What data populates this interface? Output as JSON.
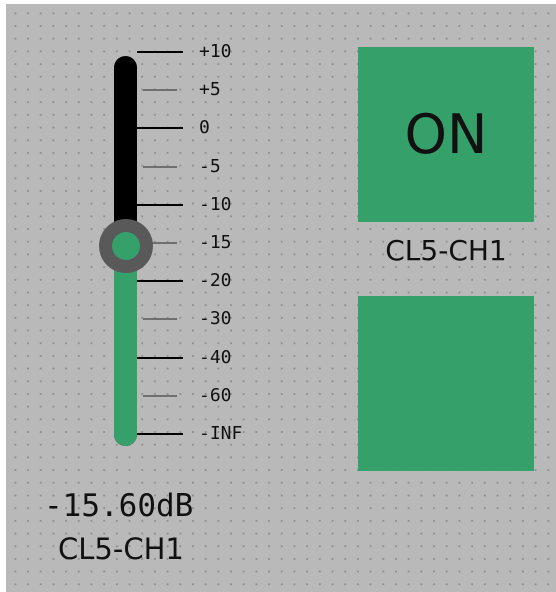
{
  "fader": {
    "level_text": "-15.60dB",
    "channel": "CL5-CH1",
    "position_fraction": 0.515,
    "scale": [
      {
        "label": "+10",
        "major": true
      },
      {
        "label": "+5",
        "major": false
      },
      {
        "label": "0",
        "major": true
      },
      {
        "label": "-5",
        "major": false
      },
      {
        "label": "-10",
        "major": true
      },
      {
        "label": "-15",
        "major": false
      },
      {
        "label": "-20",
        "major": true
      },
      {
        "label": "-30",
        "major": false
      },
      {
        "label": "-40",
        "major": true
      },
      {
        "label": "-60",
        "major": false
      },
      {
        "label": "-INF",
        "major": true
      }
    ]
  },
  "on_button": {
    "label": "ON",
    "channel": "CL5-CH1",
    "state": "on"
  },
  "second_button": {
    "label": ""
  },
  "colors": {
    "background": "#b9b9b9",
    "accent_green": "#35a06a",
    "track_dark": "#000000",
    "knob_ring": "#595959"
  }
}
